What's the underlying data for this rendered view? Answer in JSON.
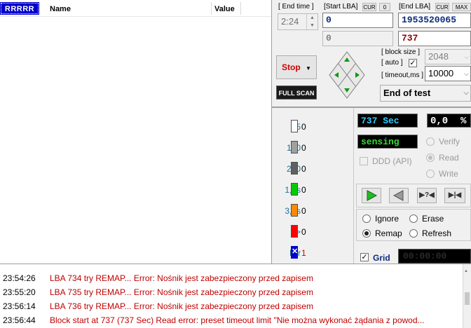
{
  "table": {
    "header_badge": "RRRRR",
    "col_name": "Name",
    "col_value": "Value"
  },
  "range": {
    "end_time_label": "[ End time ]",
    "end_time_value": "2:24",
    "start_lba_label": "[Start LBA]",
    "start_cur": "CUR",
    "start_zero": "0",
    "end_lba_label": "[End LBA]",
    "end_cur": "CUR",
    "end_max": "MAX",
    "start_lba_value": "0",
    "end_lba_value": "1953520065",
    "start_lba_secondary": "0",
    "current_lba": "737"
  },
  "controls": {
    "stop_label": "Stop",
    "full_scan_label": "FULL SCAN",
    "block_size_label": "[ block size ]",
    "auto_label": "[ auto ]",
    "auto_checked": true,
    "block_size_value": "2048",
    "timeout_label": "[ timeout,ms ]",
    "timeout_value": "10000",
    "end_action": "End of test"
  },
  "stats": [
    {
      "label": "25",
      "value": "0",
      "color": "#ffffff"
    },
    {
      "label": "100",
      "value": "0",
      "color": "#a0a0a0"
    },
    {
      "label": "250",
      "value": "0",
      "color": "#606060"
    },
    {
      "label": "1,0s",
      "value": "0",
      "color": "#00cc00"
    },
    {
      "label": "3,0s",
      "value": "0",
      "color": "#ff8800"
    },
    {
      "label": ">",
      "value": "0",
      "color": "#ff0000"
    },
    {
      "label": "Err",
      "value": "1",
      "color": "#0000cc"
    }
  ],
  "status": {
    "elapsed": "737 Sec",
    "percent": "0,0",
    "percent_unit": "%",
    "state": "sensing",
    "ddd_label": "DDD (API)",
    "verify_label": "Verify",
    "read_label": "Read",
    "write_label": "Write",
    "mode_selected": "Read"
  },
  "action": {
    "ignore_label": "Ignore",
    "erase_label": "Erase",
    "remap_label": "Remap",
    "refresh_label": "Refresh",
    "selected": "Remap",
    "grid_label": "Grid",
    "grid_checked": true,
    "grid_timer": "00:00:00"
  },
  "log": [
    {
      "time": "23:54:26",
      "msg": "LBA 734 try REMAP... Error: Nośnik jest zabezpieczony przed zapisem"
    },
    {
      "time": "23:55:20",
      "msg": "LBA 735 try REMAP... Error: Nośnik jest zabezpieczony przed zapisem"
    },
    {
      "time": "23:56:14",
      "msg": "LBA 736 try REMAP... Error: Nośnik jest zabezpieczony przed zapisem"
    },
    {
      "time": "23:56:44",
      "msg": "Block start at 737 (737 Sec) Read error: preset timeout limit \"Nie można wykonać żądania z powod..."
    }
  ],
  "colors": {
    "accent_blue": "#0000cc",
    "log_red": "#c00000",
    "lcd_cyan": "#33ccff",
    "lcd_green": "#33dd33"
  }
}
